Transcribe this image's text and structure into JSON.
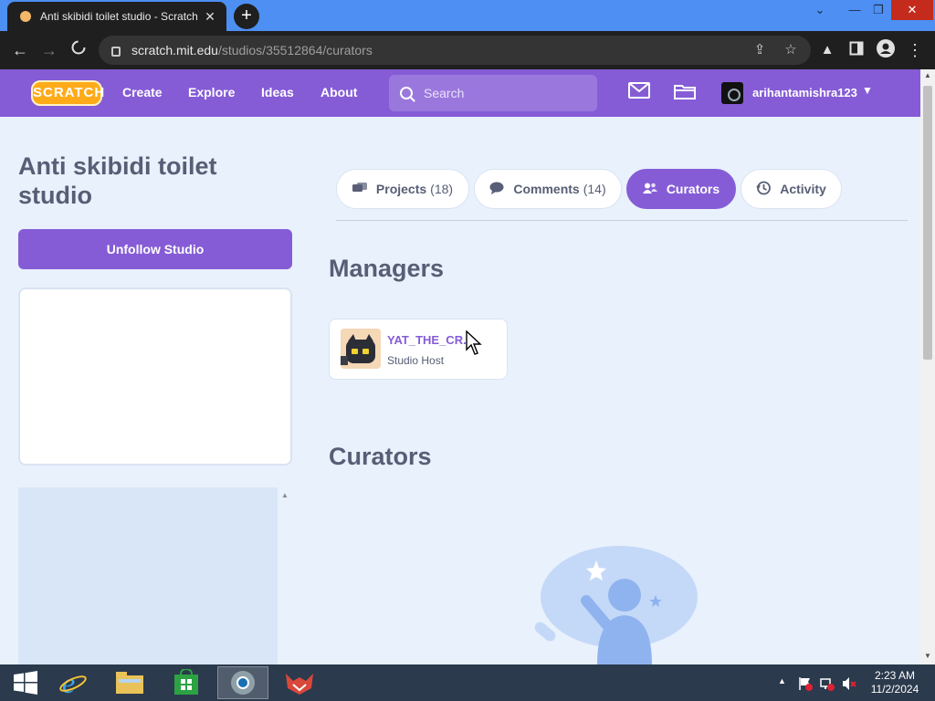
{
  "browser": {
    "tab_title": "Anti skibidi toilet studio - Scratch",
    "tab_close": "✕",
    "new_tab": "+",
    "window_controls": {
      "minimize": "—",
      "restore": "❐",
      "close": "✕",
      "tabsearch": "⌄"
    },
    "url_host": "scratch.mit.edu",
    "url_path": "/studios/35512864/curators"
  },
  "nav": {
    "logo": "SCRATCH",
    "links": [
      "Create",
      "Explore",
      "Ideas",
      "About"
    ],
    "search_placeholder": "Search",
    "username": "arihantamishra123"
  },
  "studio": {
    "title": "Anti skibidi toilet studio",
    "follow_button": "Unfollow Studio"
  },
  "tabs": [
    {
      "label": "Projects",
      "count": "(18)",
      "icon": "projects-icon",
      "active": false
    },
    {
      "label": "Comments",
      "count": "(14)",
      "icon": "comments-icon",
      "active": false
    },
    {
      "label": "Curators",
      "count": "",
      "icon": "curators-icon",
      "active": true
    },
    {
      "label": "Activity",
      "count": "",
      "icon": "activity-icon",
      "active": false
    }
  ],
  "managers": {
    "heading": "Managers",
    "items": [
      {
        "name": "YAT_THE_CR...",
        "role": "Studio Host"
      }
    ]
  },
  "curators": {
    "heading": "Curators"
  },
  "taskbar": {
    "time": "2:23 AM",
    "date": "11/2/2024"
  },
  "colors": {
    "accent": "#855cd6",
    "text": "#575e75",
    "background": "#e9f1fc"
  }
}
